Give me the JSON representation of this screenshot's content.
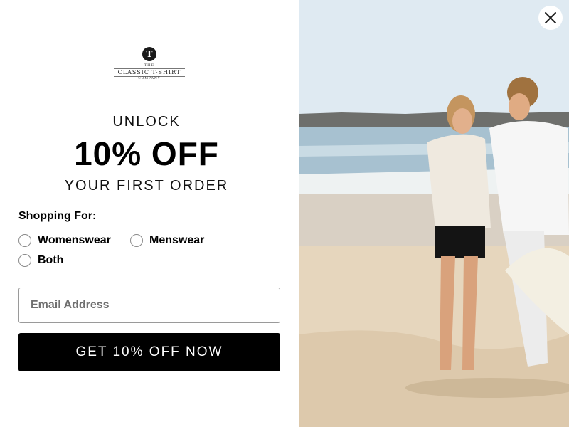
{
  "brand": {
    "logo_letter": "T",
    "logo_the": "THE",
    "logo_name": "CLASSIC T-SHIRT",
    "logo_company": "COMPANY"
  },
  "offer": {
    "unlock": "UNLOCK",
    "headline": "10% OFF",
    "subline": "YOUR FIRST ORDER"
  },
  "form": {
    "shopping_label": "Shopping For:",
    "options": [
      {
        "label": "Womenswear",
        "selected": false
      },
      {
        "label": "Menswear",
        "selected": false
      },
      {
        "label": "Both",
        "selected": false
      }
    ],
    "email_placeholder": "Email Address",
    "email_value": "",
    "cta_label": "GET 10% OFF NOW"
  },
  "icons": {
    "close": "close-icon",
    "radio": "radio-icon"
  },
  "colors": {
    "cta_background": "#000000",
    "cta_text": "#ffffff",
    "sky": "#dde9f1",
    "sea": "#a9c3d2",
    "sand": "#e6d7c0"
  }
}
